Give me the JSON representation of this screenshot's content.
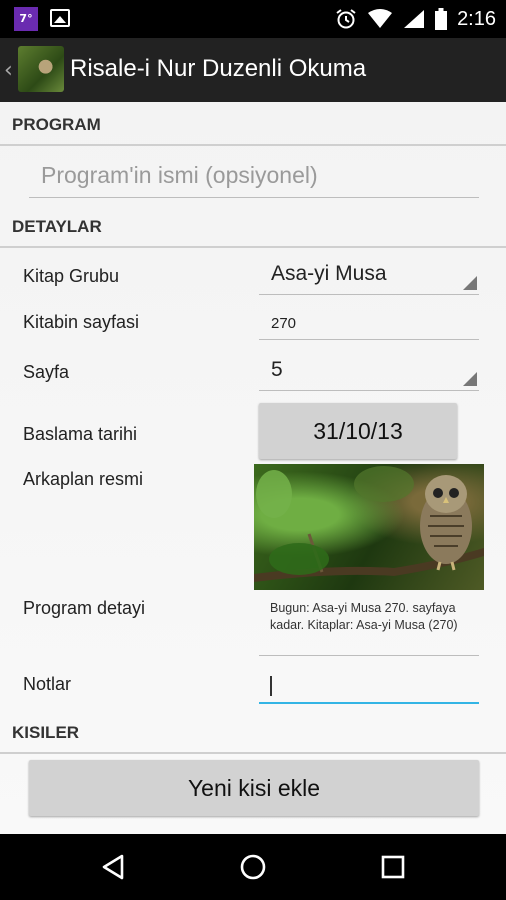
{
  "status_bar": {
    "notification_badge": "7°",
    "time": "2:16",
    "icons": [
      "gallery-icon",
      "alarm-icon",
      "wifi-icon",
      "signal-icon",
      "battery-icon"
    ]
  },
  "action_bar": {
    "title": "Risale-i Nur Duzenli Okuma",
    "back_icon": "chevron-left-icon",
    "app_icon": "owl-app-icon"
  },
  "sections": {
    "program": "PROGRAM",
    "details": "DETAYLAR",
    "people": "KISILER"
  },
  "program": {
    "name_placeholder": "Program'in ismi (opsiyonel)"
  },
  "details": {
    "book_group_label": "Kitap Grubu",
    "book_group_value": "Asa-yi Musa",
    "book_page_label": "Kitabin sayfasi",
    "book_page_value": "270",
    "page_label": "Sayfa",
    "page_value": "5",
    "start_date_label": "Baslama tarihi",
    "start_date_value": "31/10/13",
    "background_label": "Arkaplan resmi",
    "program_detail_label": "Program detayi",
    "program_detail_value": "Bugun: Asa-yi Musa 270. sayfaya kadar. Kitaplar: Asa-yi Musa (270)",
    "notes_label": "Notlar",
    "notes_value": ""
  },
  "people": {
    "add_button": "Yeni kisi ekle"
  },
  "nav_bar": {
    "buttons": [
      "back-icon",
      "home-icon",
      "recents-icon"
    ]
  },
  "colors": {
    "action_bar": "#222222",
    "focus_underline": "#33b5e5",
    "button_bg": "#d2d2d2"
  }
}
